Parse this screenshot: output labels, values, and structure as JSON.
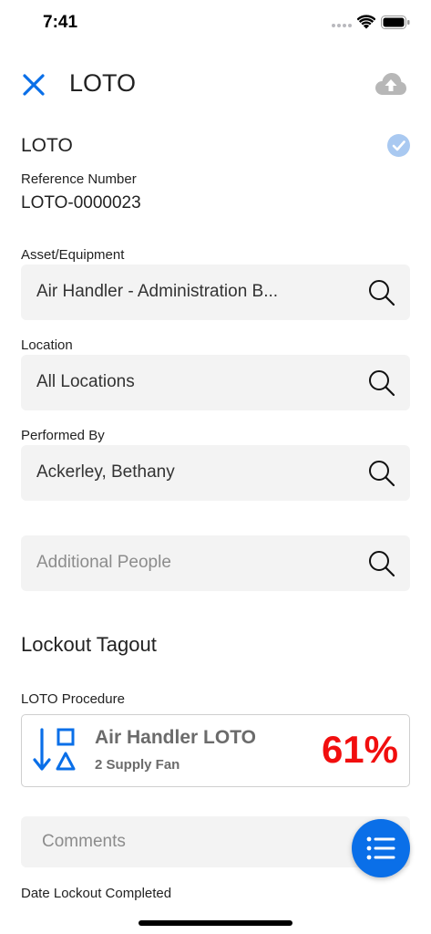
{
  "status_bar": {
    "time": "7:41"
  },
  "header": {
    "title": "LOTO",
    "close_icon": "close-icon",
    "upload_icon": "cloud-upload-icon"
  },
  "form": {
    "section_title": "LOTO",
    "reference_label": "Reference Number",
    "reference_value": "LOTO-0000023",
    "asset_label": "Asset/Equipment",
    "asset_value": "Air Handler - Administration B...",
    "location_label": "Location",
    "location_value": "All Locations",
    "performed_by_label": "Performed By",
    "performed_by_value": "Ackerley, Bethany",
    "additional_people_placeholder": "Additional People",
    "lockout_section_title": "Lockout Tagout",
    "procedure_label": "LOTO Procedure",
    "procedure": {
      "title": "Air Handler LOTO",
      "subtitle": "2 Supply Fan",
      "percent": "61%",
      "percent_color": "#f10e0e"
    },
    "comments_placeholder": "Comments",
    "date_completed_label": "Date Lockout Completed"
  },
  "colors": {
    "accent": "#0a6fe8",
    "field_background": "#f3f3f3",
    "check": "#a9c9f1"
  }
}
